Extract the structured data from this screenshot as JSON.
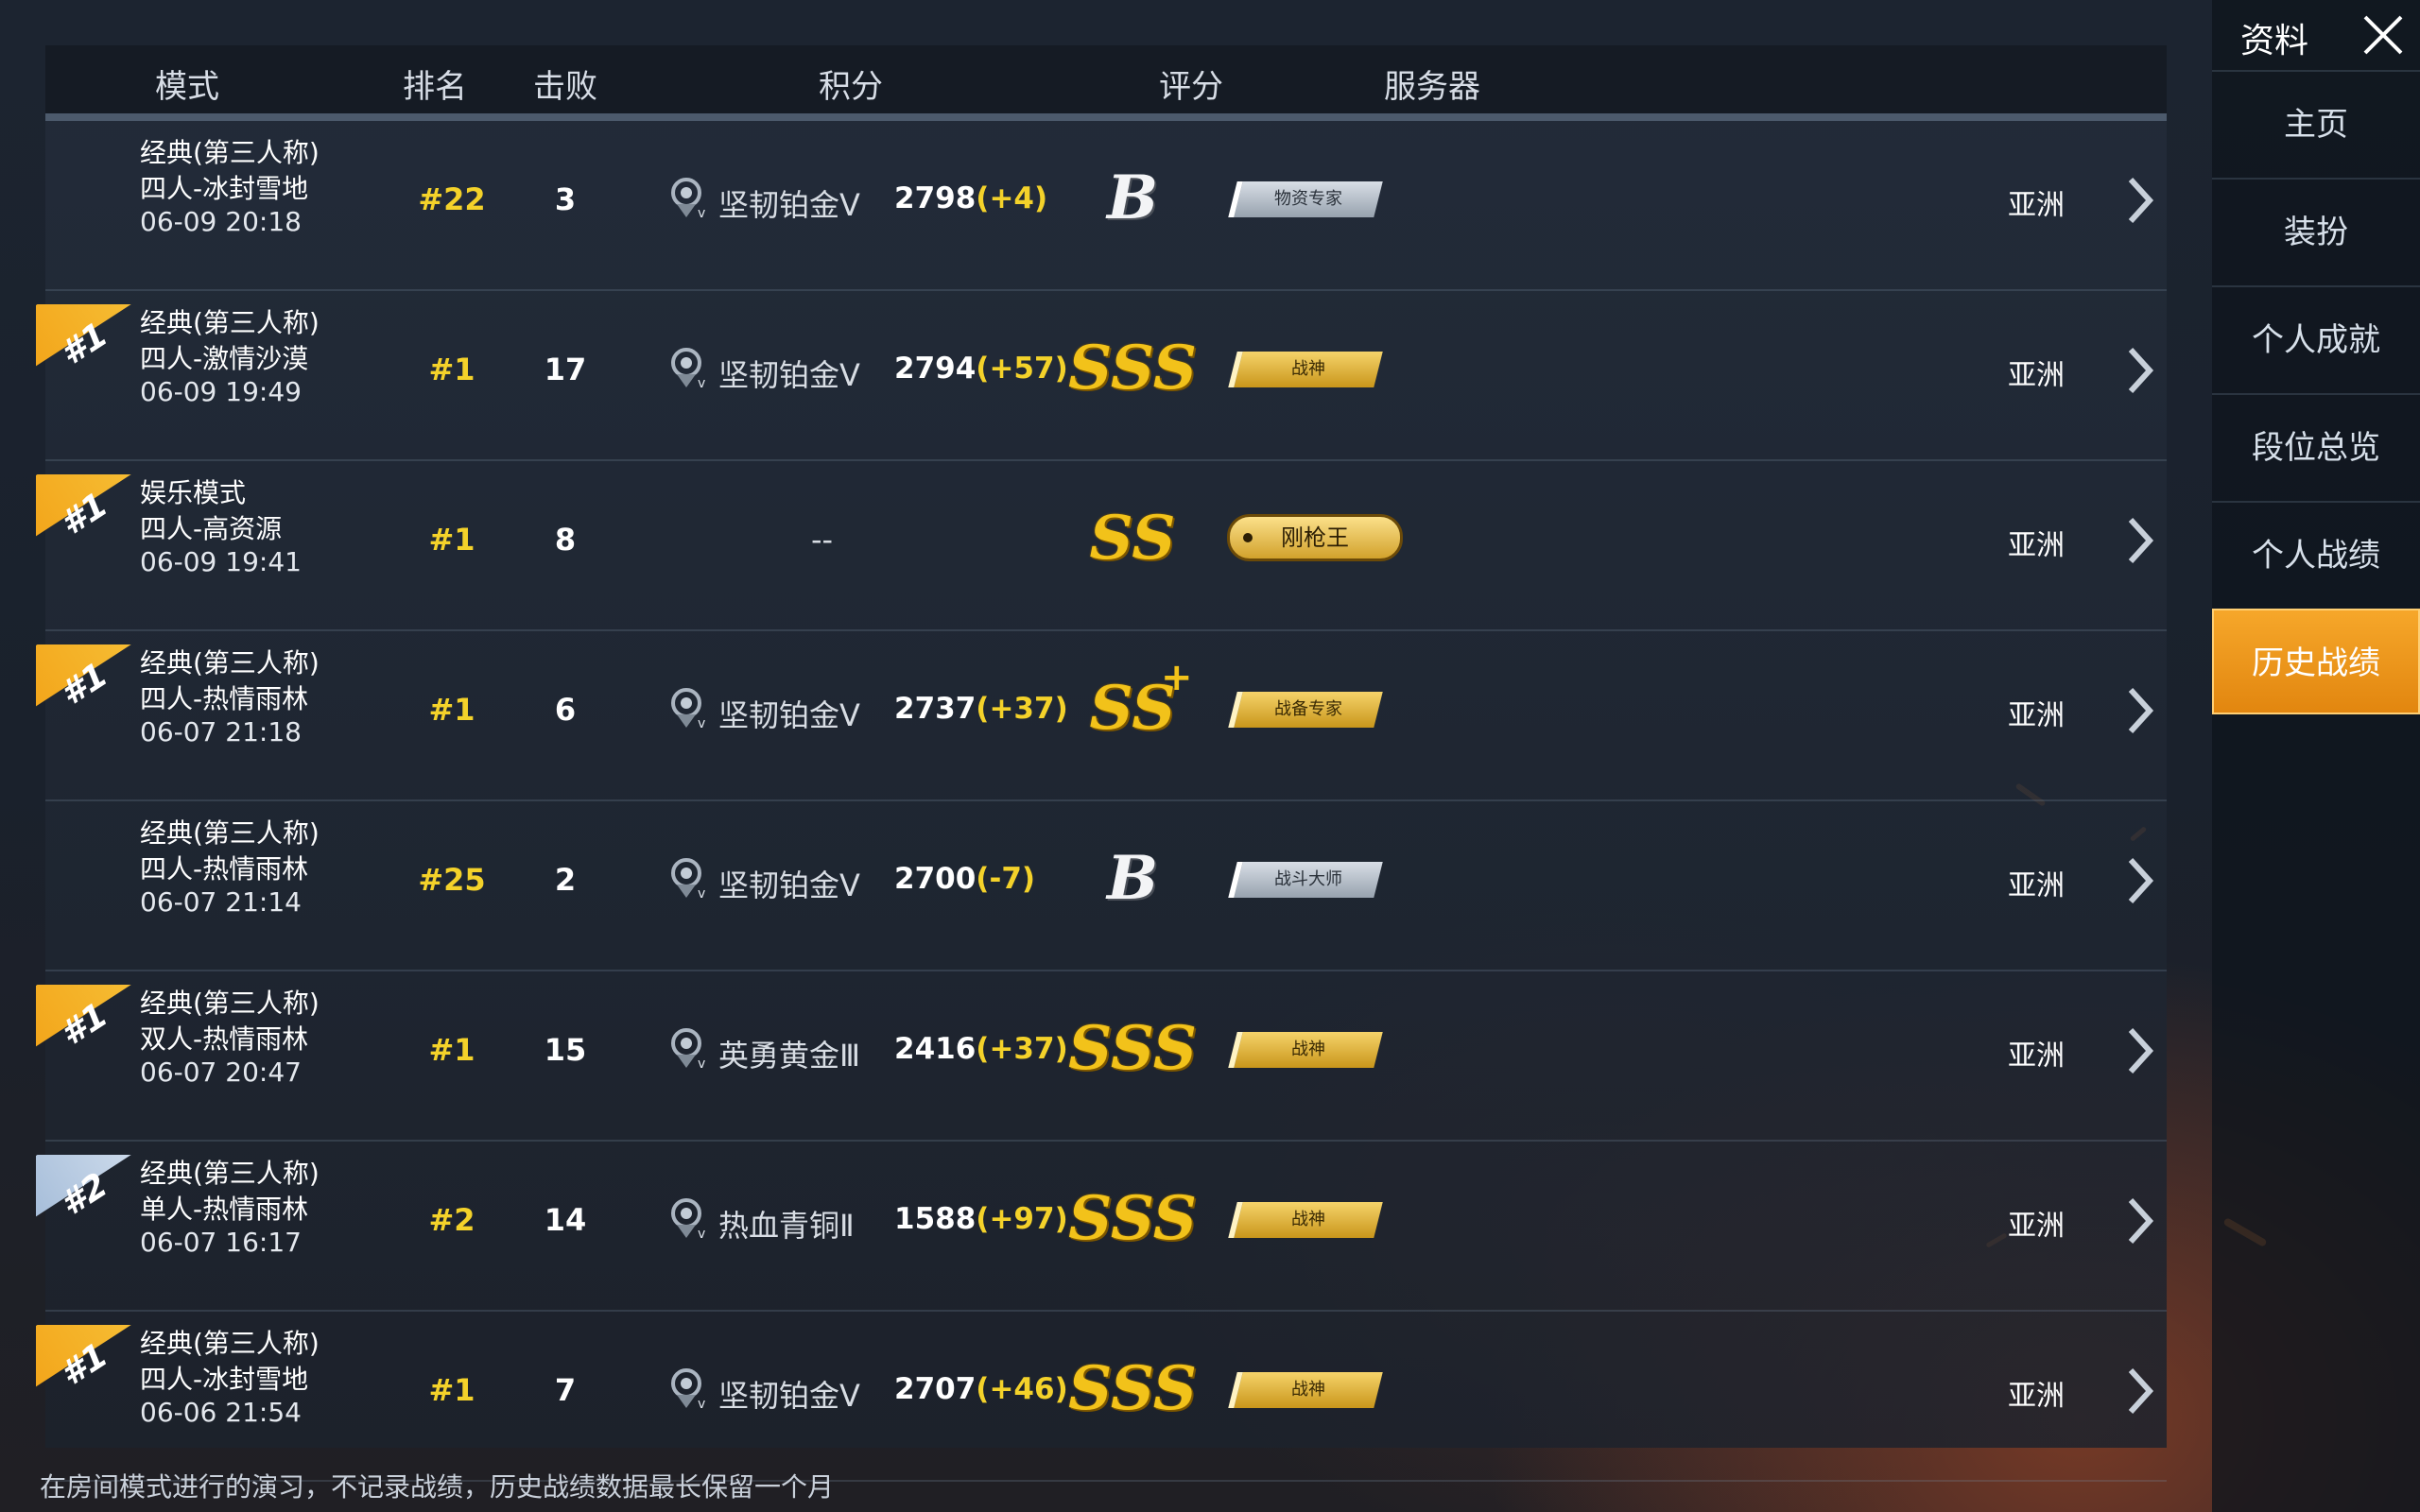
{
  "header": {
    "mode": "模式",
    "rank": "排名",
    "kills": "击败",
    "points": "积分",
    "grade": "评分",
    "server": "服务器"
  },
  "rows": [
    {
      "ribbon": "",
      "mode_line1": "经典(第三人称)",
      "mode_line2": "四人-冰封雪地",
      "time": "06-09 20:18",
      "rank": "#22",
      "kills": "3",
      "tier": "坚韧铂金Ⅴ",
      "tier_icon": "platinum-v-icon",
      "score": "2798",
      "delta": "(+4)",
      "grade": "B",
      "grade_style": "white",
      "badge": "物资专家",
      "badge_style": "silver",
      "server": "亚洲"
    },
    {
      "ribbon": "#1",
      "mode_line1": "经典(第三人称)",
      "mode_line2": "四人-激情沙漠",
      "time": "06-09 19:49",
      "rank": "#1",
      "kills": "17",
      "tier": "坚韧铂金Ⅴ",
      "tier_icon": "platinum-v-icon",
      "score": "2794",
      "delta": "(+57)",
      "grade": "SSS",
      "grade_style": "gold",
      "badge": "战神",
      "badge_style": "gold",
      "server": "亚洲"
    },
    {
      "ribbon": "#1",
      "mode_line1": "娱乐模式",
      "mode_line2": "四人-高资源",
      "time": "06-09 19:41",
      "rank": "#1",
      "kills": "8",
      "tier": "",
      "score": "",
      "delta": "",
      "dash": "--",
      "grade": "SS",
      "grade_style": "gold",
      "badge": "刚枪王",
      "badge_style": "pill",
      "server": "亚洲"
    },
    {
      "ribbon": "#1",
      "mode_line1": "经典(第三人称)",
      "mode_line2": "四人-热情雨林",
      "time": "06-07 21:18",
      "rank": "#1",
      "kills": "6",
      "tier": "坚韧铂金Ⅴ",
      "tier_icon": "platinum-v-icon",
      "score": "2737",
      "delta": "(+37)",
      "grade": "SS",
      "grade_plus": "+",
      "grade_style": "gold",
      "badge": "战备专家",
      "badge_style": "gold",
      "server": "亚洲"
    },
    {
      "ribbon": "",
      "mode_line1": "经典(第三人称)",
      "mode_line2": "四人-热情雨林",
      "time": "06-07 21:14",
      "rank": "#25",
      "kills": "2",
      "tier": "坚韧铂金Ⅴ",
      "tier_icon": "platinum-v-icon",
      "score": "2700",
      "delta": "(-7)",
      "grade": "B",
      "grade_style": "white",
      "badge": "战斗大师",
      "badge_style": "silver",
      "server": "亚洲"
    },
    {
      "ribbon": "#1",
      "mode_line1": "经典(第三人称)",
      "mode_line2": "双人-热情雨林",
      "time": "06-07 20:47",
      "rank": "#1",
      "kills": "15",
      "tier": "英勇黄金Ⅲ",
      "tier_icon": "gold-iii-icon",
      "score": "2416",
      "delta": "(+37)",
      "grade": "SSS",
      "grade_style": "gold",
      "badge": "战神",
      "badge_style": "gold",
      "server": "亚洲"
    },
    {
      "ribbon": "#2",
      "mode_line1": "经典(第三人称)",
      "mode_line2": "单人-热情雨林",
      "time": "06-07 16:17",
      "rank": "#2",
      "kills": "14",
      "tier": "热血青铜Ⅱ",
      "tier_icon": "bronze-ii-icon",
      "score": "1588",
      "delta": "(+97)",
      "grade": "SSS",
      "grade_style": "gold",
      "badge": "战神",
      "badge_style": "gold",
      "server": "亚洲"
    },
    {
      "ribbon": "#1",
      "mode_line1": "经典(第三人称)",
      "mode_line2": "四人-冰封雪地",
      "time": "06-06 21:54",
      "rank": "#1",
      "kills": "7",
      "tier": "坚韧铂金Ⅴ",
      "tier_icon": "platinum-v-icon",
      "score": "2707",
      "delta": "(+46)",
      "grade": "SSS",
      "grade_style": "gold",
      "badge": "战神",
      "badge_style": "gold",
      "server": "亚洲"
    }
  ],
  "footer_note": "在房间模式进行的演习，不记录战绩，历史战绩数据最长保留一个月",
  "sidebar": {
    "title": "资料",
    "items": [
      "主页",
      "装扮",
      "个人成就",
      "段位总览",
      "个人战绩",
      "历史战绩"
    ],
    "active_index": 5
  },
  "colors": {
    "accent": "#f4a52a",
    "highlight_text": "#f4d22a"
  }
}
